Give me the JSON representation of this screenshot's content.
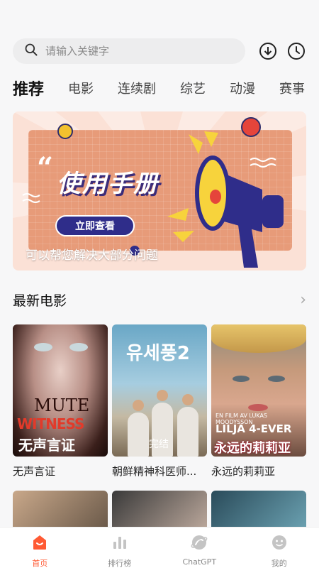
{
  "search": {
    "placeholder": "请输入关键字"
  },
  "header_icons": [
    "download-icon",
    "history-icon"
  ],
  "tabs": [
    "推荐",
    "电影",
    "连续剧",
    "综艺",
    "动漫",
    "赛事"
  ],
  "banner": {
    "title": "使用手册",
    "button": "立即查看",
    "caption": "可以帮您解决大部分问题"
  },
  "section": {
    "title": "最新电影",
    "arrow": "›"
  },
  "movies": [
    {
      "title": "无声言证",
      "poster_text_main": "WITNESS",
      "poster_text_sub": "无声言证",
      "poster_text_top": "MUTE"
    },
    {
      "title": "朝鲜精神科医师...",
      "poster_text_main": "유세풍2",
      "poster_text_sub": "完结"
    },
    {
      "title": "永远的莉莉亚",
      "poster_text_line1": "EN FILM AV LUKAS MOODYSSON",
      "poster_text_main": "LILJA 4-EVER",
      "poster_text_sub": "永远的莉莉亚"
    }
  ],
  "tabbar": [
    {
      "label": "首页",
      "icon": "home-icon",
      "active": true
    },
    {
      "label": "排行榜",
      "icon": "ranking-icon",
      "active": false
    },
    {
      "label": "ChatGPT",
      "icon": "chatgpt-icon",
      "active": false
    },
    {
      "label": "我的",
      "icon": "profile-icon",
      "active": false
    }
  ],
  "colors": {
    "accent": "#ff5a34",
    "banner_bg": "#fbe1d6",
    "banner_card": "#e79b79",
    "banner_button": "#2f2d8a"
  }
}
